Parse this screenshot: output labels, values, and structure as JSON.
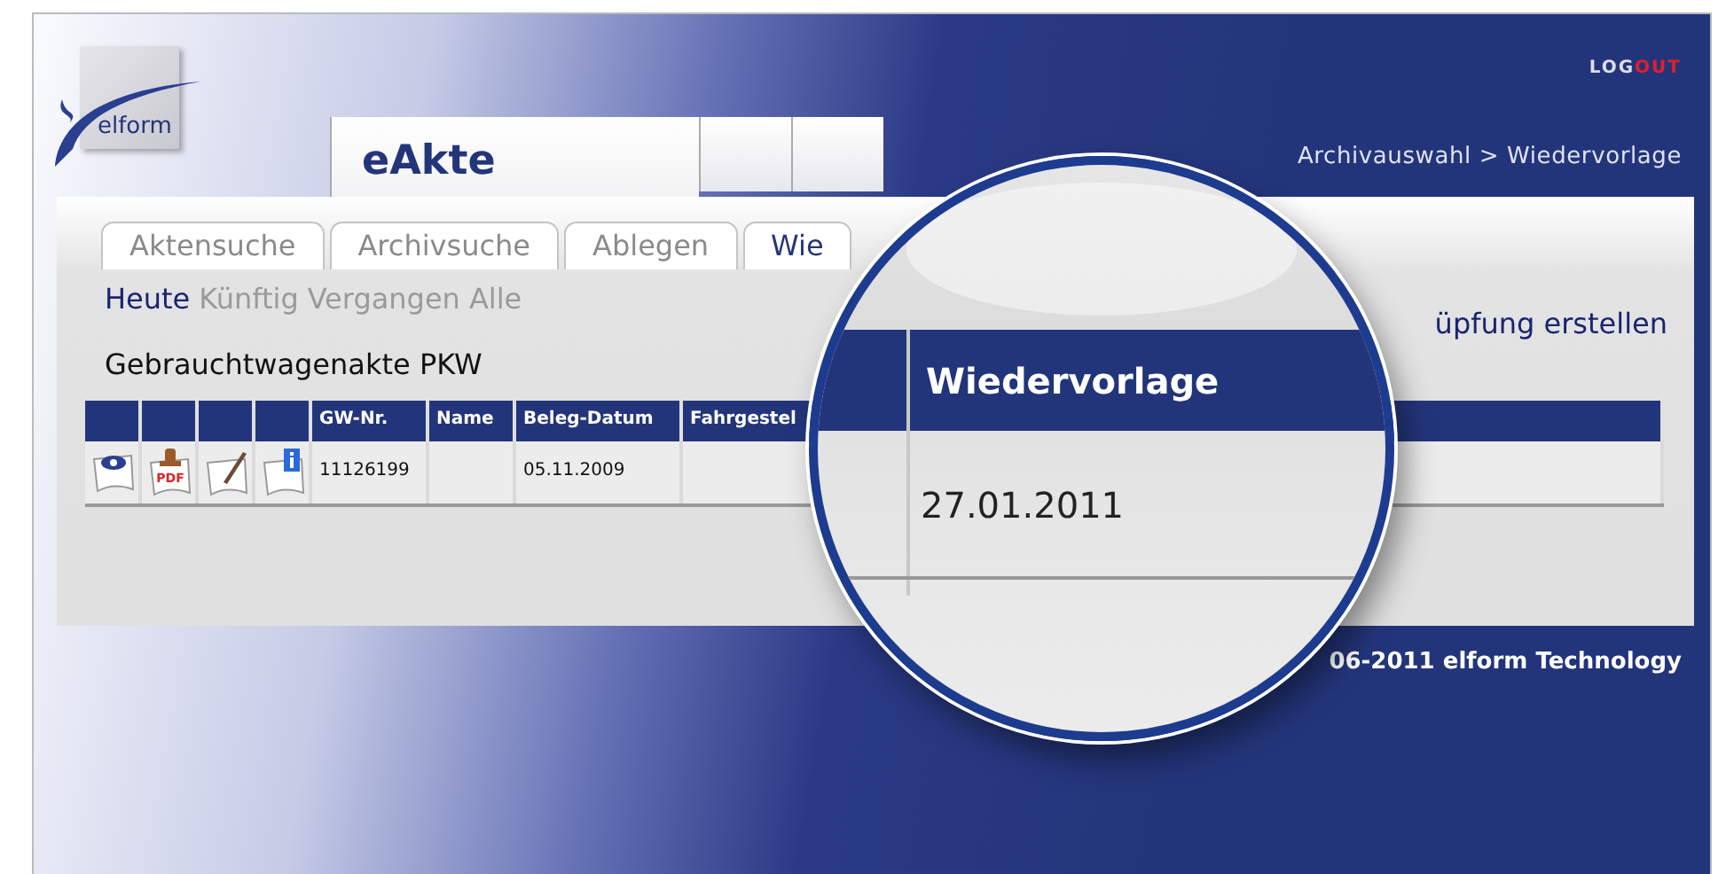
{
  "logo": {
    "text": "elform"
  },
  "app_tab": "eAkte",
  "logout": {
    "parts": [
      "LOG",
      "OUT"
    ]
  },
  "breadcrumb": "Archivauswahl > Wiedervorlage",
  "tabs": [
    {
      "label": "Aktensuche",
      "selected": false
    },
    {
      "label": "Archivsuche",
      "selected": false
    },
    {
      "label": "Ablegen",
      "selected": false
    },
    {
      "label": "Wie",
      "selected": true
    }
  ],
  "filters": [
    {
      "label": "Heute",
      "selected": true
    },
    {
      "label": "Künftig",
      "selected": false
    },
    {
      "label": "Vergangen",
      "selected": false
    },
    {
      "label": "Alle",
      "selected": false
    }
  ],
  "link_action": "üpfung erstellen",
  "title": "Gebrauchtwagenakte PKW",
  "table": {
    "columns": [
      "",
      "",
      "",
      "",
      "GW-Nr.",
      "Name",
      "Beleg-Datum",
      "Fahrgestel"
    ],
    "rows": [
      {
        "actions": [
          {
            "kind": "view"
          },
          {
            "kind": "pdf",
            "label": "PDF"
          },
          {
            "kind": "edit"
          },
          {
            "kind": "info"
          }
        ],
        "cells": [
          "11126199",
          "",
          "05.11.2009",
          ""
        ]
      }
    ]
  },
  "magnifier": {
    "column": "Wiedervorlage",
    "value": "27.01.2011"
  },
  "footer": "06-2011 elform Technology"
}
